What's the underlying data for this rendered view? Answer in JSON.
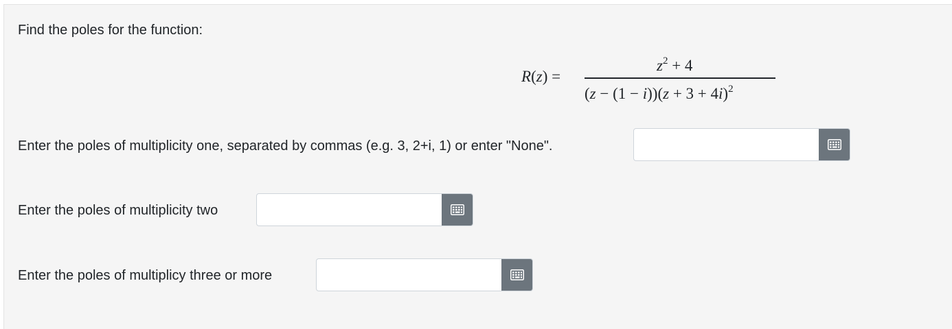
{
  "question": {
    "intro": "Find the poles for the function:",
    "equation": {
      "lhs": "R(z) =",
      "numerator": "z² + 4",
      "denominator": "(z − (1 − i))(z + 3 + 4i)²"
    }
  },
  "fields": [
    {
      "label": "Enter the poles of multiplicity one, separated by commas (e.g. 3, 2+i, 1) or enter \"None\".",
      "value": "",
      "button_icon": "keypad-icon"
    },
    {
      "label": "Enter the poles of multiplicity two",
      "value": "",
      "button_icon": "keypad-icon"
    },
    {
      "label": "Enter the poles of multiplicy three or more",
      "value": "",
      "button_icon": "keypad-icon"
    }
  ],
  "colors": {
    "panel_background": "#f5f5f5",
    "button_background": "#6c757d",
    "text": "#212529"
  }
}
